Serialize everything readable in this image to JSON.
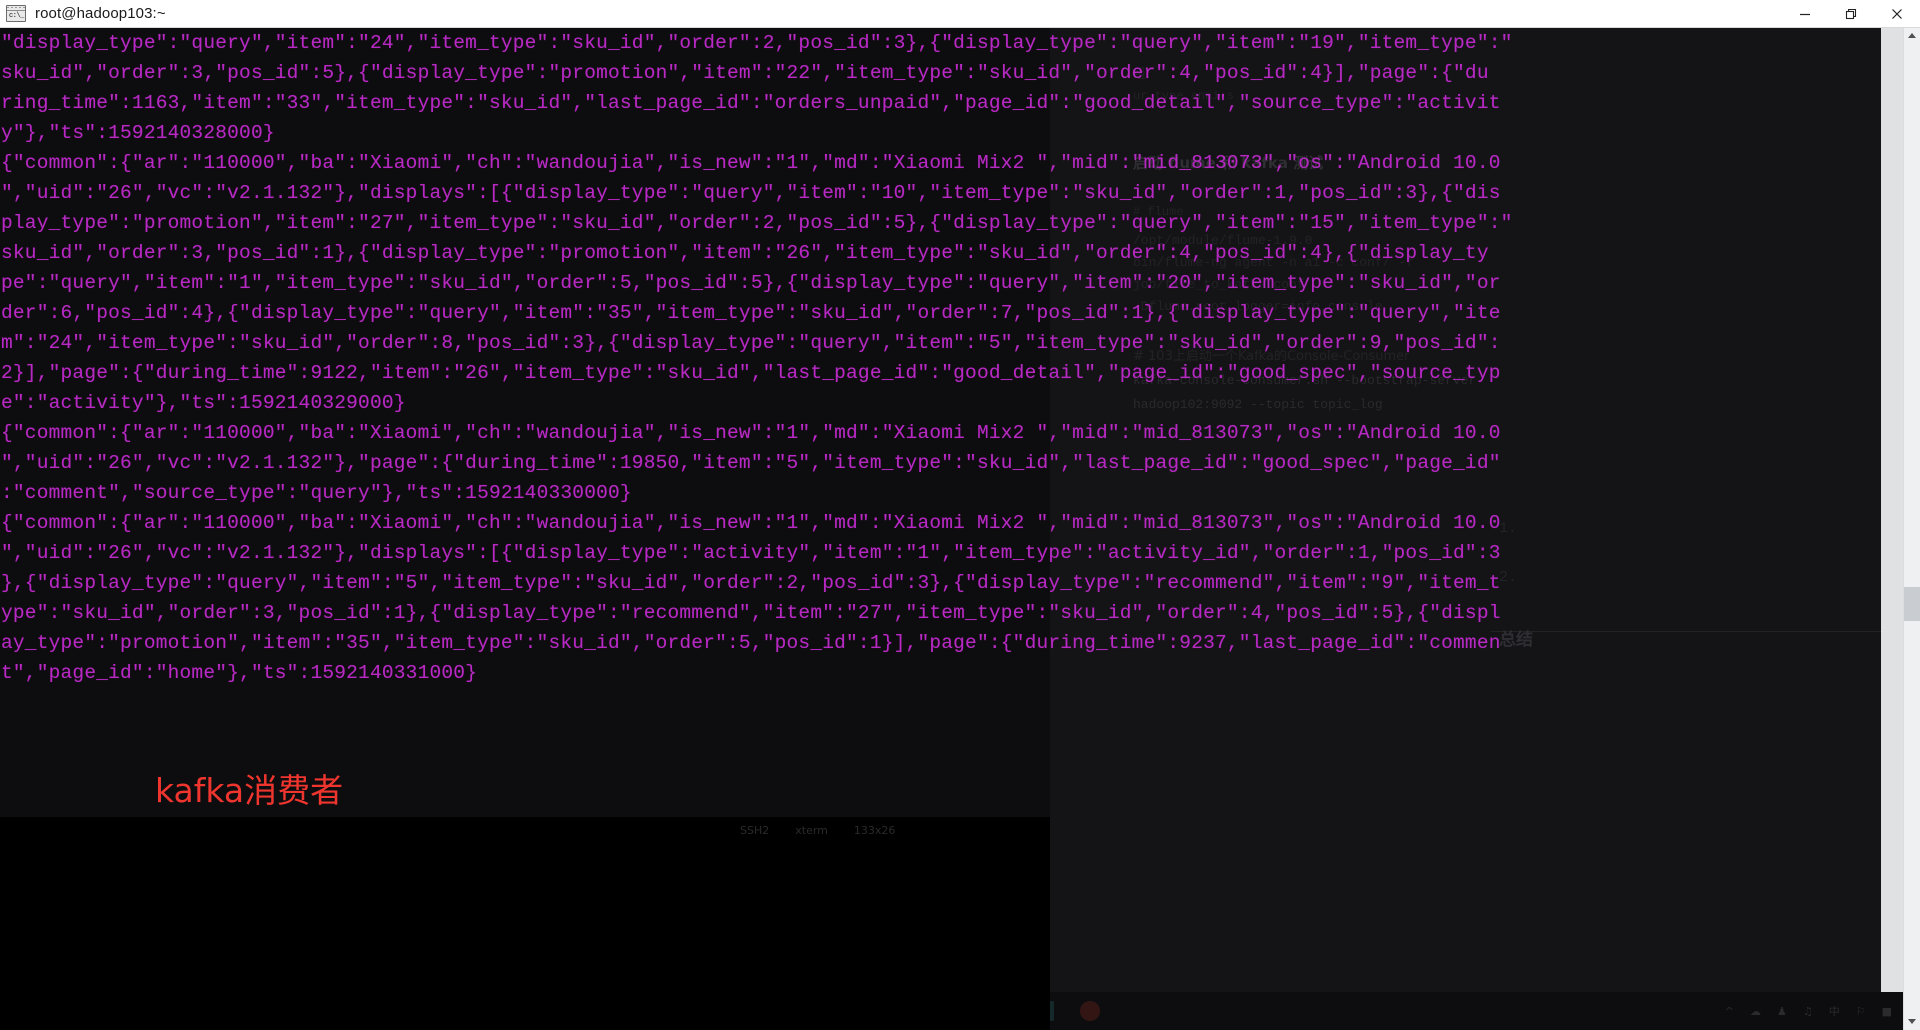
{
  "window": {
    "title": "root@hadoop103:~",
    "icon": "console-icon",
    "controls": {
      "minimize": "minimize-icon",
      "restore": "restore-icon",
      "close": "close-icon"
    }
  },
  "terminal": {
    "status": {
      "protocol": "SSH2",
      "emulation": "xterm",
      "size": "133x26"
    },
    "overlay_label": "kafka消费者",
    "overlay_label_color": "#f0352f",
    "text_color": "#b829c4",
    "background_color": "#0d0d0f",
    "lines": [
      "\"display_type\":\"query\",\"item\":\"24\",\"item_type\":\"sku_id\",\"order\":2,\"pos_id\":3},{\"display_type\":\"query\",\"item\":\"19\",\"item_type\":\"",
      "sku_id\",\"order\":3,\"pos_id\":5},{\"display_type\":\"promotion\",\"item\":\"22\",\"item_type\":\"sku_id\",\"order\":4,\"pos_id\":4}],\"page\":{\"du",
      "ring_time\":1163,\"item\":\"33\",\"item_type\":\"sku_id\",\"last_page_id\":\"orders_unpaid\",\"page_id\":\"good_detail\",\"source_type\":\"activit",
      "y\"},\"ts\":1592140328000}",
      "{\"common\":{\"ar\":\"110000\",\"ba\":\"Xiaomi\",\"ch\":\"wandoujia\",\"is_new\":\"1\",\"md\":\"Xiaomi Mix2 \",\"mid\":\"mid_813073\",\"os\":\"Android 10.0",
      "\",\"uid\":\"26\",\"vc\":\"v2.1.132\"},\"displays\":[{\"display_type\":\"query\",\"item\":\"10\",\"item_type\":\"sku_id\",\"order\":1,\"pos_id\":3},{\"dis",
      "play_type\":\"promotion\",\"item\":\"27\",\"item_type\":\"sku_id\",\"order\":2,\"pos_id\":5},{\"display_type\":\"query\",\"item\":\"15\",\"item_type\":\"",
      "sku_id\",\"order\":3,\"pos_id\":1},{\"display_type\":\"promotion\",\"item\":\"26\",\"item_type\":\"sku_id\",\"order\":4,\"pos_id\":4},{\"display_ty",
      "pe\":\"query\",\"item\":\"1\",\"item_type\":\"sku_id\",\"order\":5,\"pos_id\":5},{\"display_type\":\"query\",\"item\":\"20\",\"item_type\":\"sku_id\",\"or",
      "der\":6,\"pos_id\":4},{\"display_type\":\"query\",\"item\":\"35\",\"item_type\":\"sku_id\",\"order\":7,\"pos_id\":1},{\"display_type\":\"query\",\"ite",
      "m\":\"24\",\"item_type\":\"sku_id\",\"order\":8,\"pos_id\":3},{\"display_type\":\"query\",\"item\":\"5\",\"item_type\":\"sku_id\",\"order\":9,\"pos_id\":",
      "2}],\"page\":{\"during_time\":9122,\"item\":\"26\",\"item_type\":\"sku_id\",\"last_page_id\":\"good_detail\",\"page_id\":\"good_spec\",\"source_typ",
      "e\":\"activity\"},\"ts\":1592140329000}",
      "{\"common\":{\"ar\":\"110000\",\"ba\":\"Xiaomi\",\"ch\":\"wandoujia\",\"is_new\":\"1\",\"md\":\"Xiaomi Mix2 \",\"mid\":\"mid_813073\",\"os\":\"Android 10.0",
      "\",\"uid\":\"26\",\"vc\":\"v2.1.132\"},\"page\":{\"during_time\":19850,\"item\":\"5\",\"item_type\":\"sku_id\",\"last_page_id\":\"good_spec\",\"page_id\"",
      ":\"comment\",\"source_type\":\"query\"},\"ts\":1592140330000}",
      "{\"common\":{\"ar\":\"110000\",\"ba\":\"Xiaomi\",\"ch\":\"wandoujia\",\"is_new\":\"1\",\"md\":\"Xiaomi Mix2 \",\"mid\":\"mid_813073\",\"os\":\"Android 10.0",
      "\",\"uid\":\"26\",\"vc\":\"v2.1.132\"},\"displays\":[{\"display_type\":\"activity\",\"item\":\"1\",\"item_type\":\"activity_id\",\"order\":1,\"pos_id\":3",
      "},{\"display_type\":\"query\",\"item\":\"5\",\"item_type\":\"sku_id\",\"order\":2,\"pos_id\":3},{\"display_type\":\"recommend\",\"item\":\"9\",\"item_t",
      "ype\":\"sku_id\",\"order\":3,\"pos_id\":1},{\"display_type\":\"recommend\",\"item\":\"27\",\"item_type\":\"sku_id\",\"order\":4,\"pos_id\":5},{\"displ",
      "ay_type\":\"promotion\",\"item\":\"35\",\"item_type\":\"sku_id\",\"order\":5,\"pos_id\":1}],\"page\":{\"during_time\":9237,\"last_page_id\":\"commen",
      "t\",\"page_id\":\"home\"},\"ts\":1592140331000}"
    ]
  },
  "background_document": {
    "note": "Faintly visible window bleeding through behind the terminal",
    "lines": [
      "组:",
      "ur_type  anni:s",
      "启动 flume 和 kafka 测试",
      "# flume",
      "/opt/module/flume-1.9.0",
      "bin/flume-ng agent -n a1 -c conf/ -f",
      "job/file_to_kafka.conf",
      "-Dflume.root.logger=info,console",
      "# 103上启动一个Kafka的Console-Consumer",
      "kafka-console-consumer.sh --bootstrap-server",
      "hadoop102:9092 --topic topic_log"
    ],
    "outline": [
      "1.",
      "2.",
      "总结"
    ],
    "left_ghost_items": [
      "NUM"
    ]
  },
  "scrollbar": {
    "up_arrow": "chevron-up-icon",
    "down_arrow": "chevron-down-icon",
    "thumb": "scroll-thumb"
  },
  "taskbar": {
    "items": [
      {
        "name": "start-button",
        "color": "#2a5fa5"
      },
      {
        "name": "search-icon",
        "color": "#3a3a3a"
      },
      {
        "name": "task-view-icon",
        "color": "#2f2f2f"
      },
      {
        "name": "powerpoint-icon",
        "color": "#a6431f"
      },
      {
        "name": "pdf-reader-icon",
        "color": "#1f3f7a"
      },
      {
        "name": "word-icon",
        "color": "#1c4f8a"
      },
      {
        "name": "notes-icon",
        "color": "#8a6a1e"
      },
      {
        "name": "chrome-icon",
        "color": "#7a6a22"
      },
      {
        "name": "editor-icon",
        "color": "#4a4a4a"
      },
      {
        "name": "terminal-icon",
        "color": "#2a6a6a"
      },
      {
        "name": "browser-icon",
        "color": "#8a2a22"
      }
    ],
    "tray": [
      "^",
      "cloud-icon",
      "user-icon",
      "volume-icon",
      "ime-icon",
      "network-icon",
      "more-icon"
    ]
  }
}
